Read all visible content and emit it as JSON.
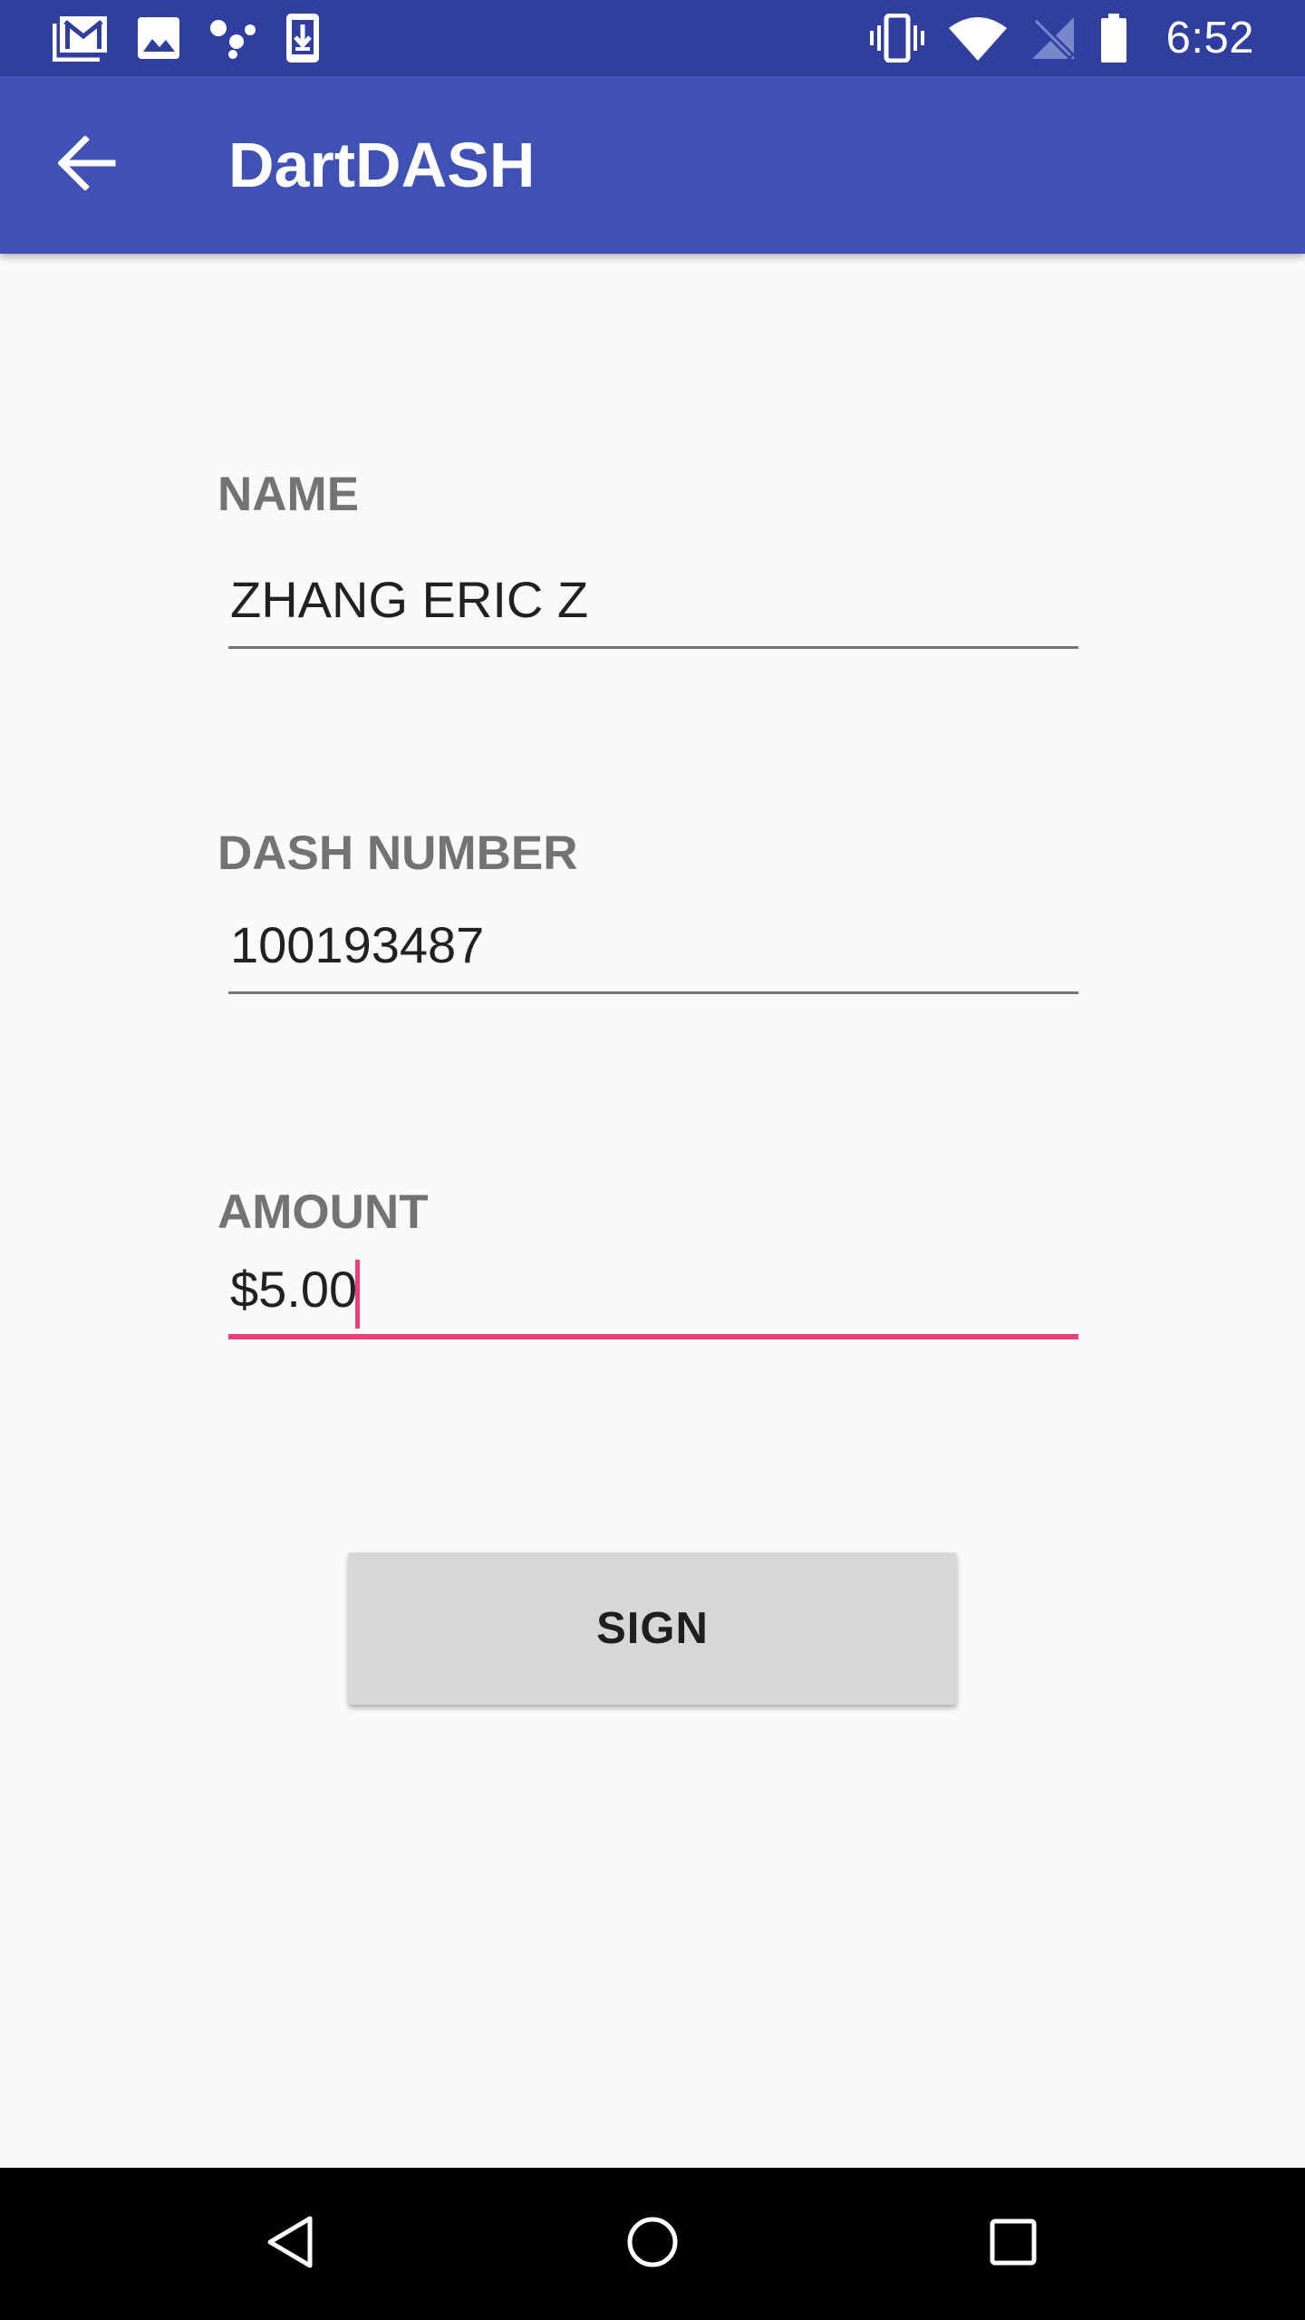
{
  "status_bar": {
    "time": "6:52",
    "left_icons": [
      "gmail-icon",
      "image-icon",
      "assistant-icon",
      "download-icon"
    ],
    "right_icons": [
      "vibrate-icon",
      "wifi-icon",
      "no-signal-icon",
      "battery-icon"
    ],
    "background_color": "#303f9f"
  },
  "app_bar": {
    "title": "DartDASH",
    "back_icon": "arrow-back-icon",
    "background_color": "#3f51b5"
  },
  "form": {
    "name": {
      "label": "NAME",
      "value": "ZHANG ERIC Z"
    },
    "dash_number": {
      "label": "DASH NUMBER",
      "value": "100193487"
    },
    "amount": {
      "label": "AMOUNT",
      "value": "$5.00",
      "focused": true
    },
    "accent_color": "#ec407a"
  },
  "sign_button": {
    "label": "SIGN"
  },
  "nav_bar": {
    "icons": [
      "back-triangle-icon",
      "home-circle-icon",
      "recents-square-icon"
    ]
  }
}
